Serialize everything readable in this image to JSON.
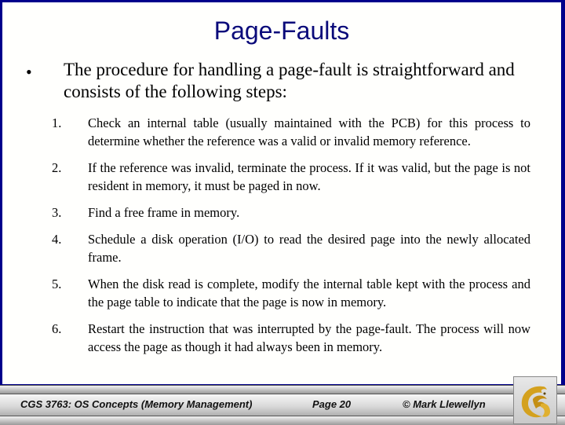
{
  "slide": {
    "title": "Page-Faults",
    "bullet_symbol": "•",
    "intro": "The procedure for handling a page-fault is straightforward and consists of the following steps:",
    "steps": [
      {
        "num": "1.",
        "text": "Check an internal table (usually maintained with the PCB) for this process to determine whether the reference was a valid or invalid memory reference."
      },
      {
        "num": "2.",
        "text": "If the reference was invalid, terminate the process.  If it was valid, but the page is not resident in memory, it must be paged in now."
      },
      {
        "num": "3.",
        "text": "Find a free frame in memory."
      },
      {
        "num": "4.",
        "text": "Schedule a disk operation (I/O) to read the desired page into the newly allocated frame."
      },
      {
        "num": "5.",
        "text": "When the disk read is complete, modify the internal table kept with the process and the page table to indicate that the page is now in memory."
      },
      {
        "num": "6.",
        "text": "Restart the instruction that was interrupted by the page-fault.  The process will now access the page as though it had always been in  memory."
      }
    ]
  },
  "footer": {
    "course": "CGS 3763: OS Concepts  (Memory Management)",
    "page": "Page 20",
    "copyright": "© Mark Llewellyn",
    "logo_icon": "pegasus-logo-icon"
  },
  "colors": {
    "border": "#00008b",
    "title": "#0a0a7a",
    "logo_gold": "#d4a11e"
  }
}
